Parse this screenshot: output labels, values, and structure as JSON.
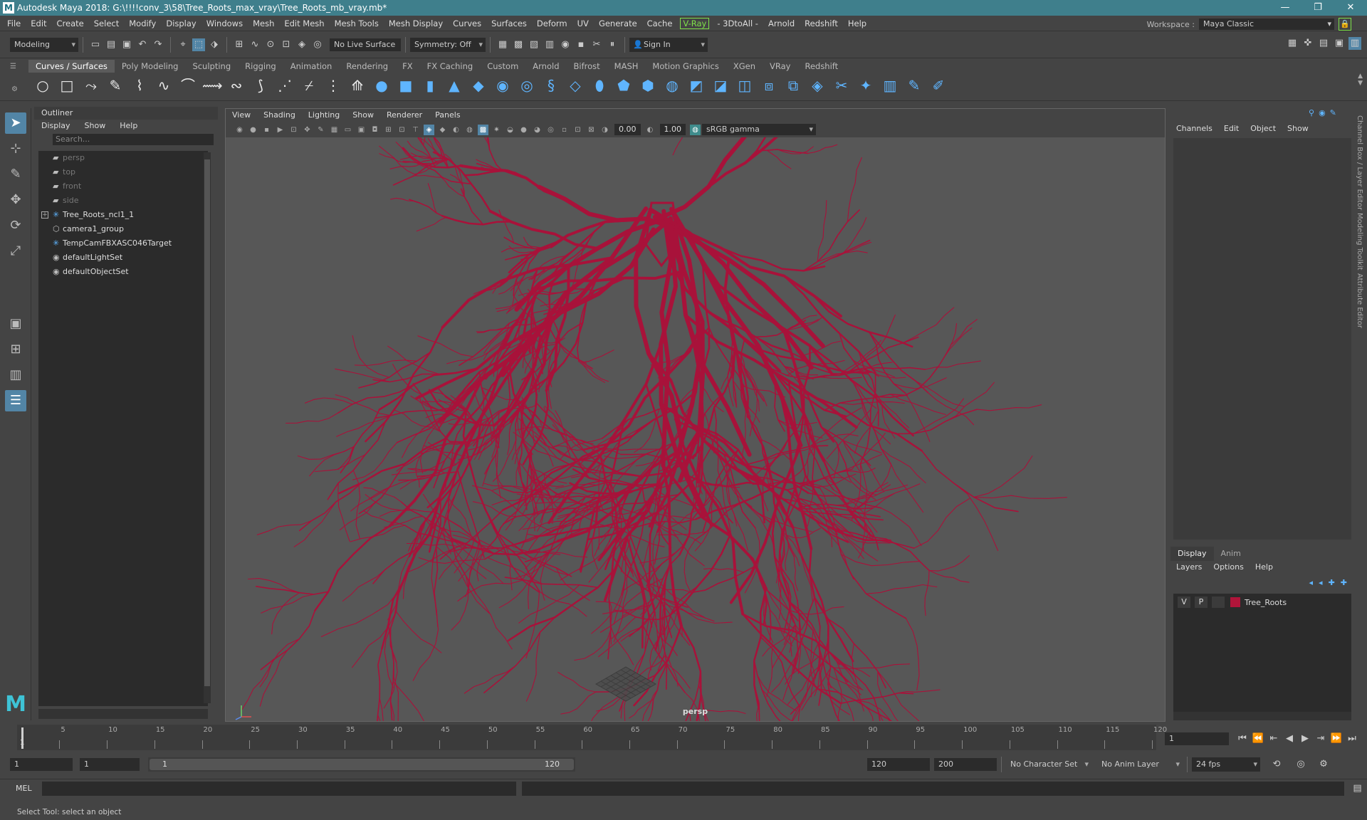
{
  "window": {
    "title": "Autodesk Maya 2018: G:\\!!!!conv_3\\58\\Tree_Roots_max_vray\\Tree_Roots_mb_vray.mb*",
    "logo": "M",
    "minimize": "—",
    "maximize": "❐",
    "close": "✕"
  },
  "menu": {
    "items": [
      "File",
      "Edit",
      "Create",
      "Select",
      "Modify",
      "Display",
      "Windows",
      "Mesh",
      "Edit Mesh",
      "Mesh Tools",
      "Mesh Display",
      "Curves",
      "Surfaces",
      "Deform",
      "UV",
      "Generate",
      "Cache"
    ],
    "vray": "V-Ray",
    "items2": [
      "- 3DtoAll -",
      "Arnold",
      "Redshift",
      "Help"
    ],
    "workspace_label": "Workspace :",
    "workspace_value": "Maya Classic"
  },
  "statusline": {
    "mode": "Modeling",
    "live_surface": "No Live Surface",
    "symmetry": "Symmetry: Off",
    "sign_in": "Sign In"
  },
  "shelf": {
    "tabs": [
      "Curves / Surfaces",
      "Poly Modeling",
      "Sculpting",
      "Rigging",
      "Animation",
      "Rendering",
      "FX",
      "FX Caching",
      "Custom",
      "Arnold",
      "Bifrost",
      "MASH",
      "Motion Graphics",
      "XGen",
      "VRay",
      "Redshift"
    ],
    "active_tab": "Curves / Surfaces"
  },
  "outliner": {
    "title": "Outliner",
    "menu": [
      "Display",
      "Show",
      "Help"
    ],
    "search_placeholder": "Search...",
    "items": [
      {
        "label": "persp",
        "icon": "camera-icon",
        "dim": true
      },
      {
        "label": "top",
        "icon": "camera-icon",
        "dim": true
      },
      {
        "label": "front",
        "icon": "camera-icon",
        "dim": true
      },
      {
        "label": "side",
        "icon": "camera-icon",
        "dim": true
      },
      {
        "label": "Tree_Roots_ncl1_1",
        "icon": "transform-icon",
        "dim": false,
        "expandable": true
      },
      {
        "label": "camera1_group",
        "icon": "group-icon",
        "dim": false
      },
      {
        "label": "TempCamFBXASC046Target",
        "icon": "transform-icon",
        "dim": false
      },
      {
        "label": "defaultLightSet",
        "icon": "set-icon",
        "dim": false
      },
      {
        "label": "defaultObjectSet",
        "icon": "set-icon",
        "dim": false
      }
    ]
  },
  "viewport": {
    "menu": [
      "View",
      "Shading",
      "Lighting",
      "Show",
      "Renderer",
      "Panels"
    ],
    "exposure": "0.00",
    "gamma": "1.00",
    "color_space": "sRGB gamma",
    "camera": "persp",
    "mesh_color": "#a8123a"
  },
  "channelbox": {
    "menu": [
      "Channels",
      "Edit",
      "Object",
      "Show"
    ],
    "side_tabs": [
      "Channel Box / Layer Editor",
      "Modeling Toolkit",
      "Attribute Editor"
    ]
  },
  "layers": {
    "tabs": [
      "Display",
      "Anim"
    ],
    "active_tab": "Display",
    "menu": [
      "Layers",
      "Options",
      "Help"
    ],
    "rows": [
      {
        "v": "V",
        "p": "P",
        "name": "Tree_Roots",
        "color": "#b0153a"
      }
    ]
  },
  "timeline": {
    "ticks": [
      "5",
      "10",
      "15",
      "20",
      "25",
      "30",
      "35",
      "40",
      "45",
      "50",
      "55",
      "60",
      "65",
      "70",
      "75",
      "80",
      "85",
      "90",
      "95",
      "100",
      "105",
      "110",
      "115",
      "120"
    ],
    "current_frame": "1",
    "first_tick": "1"
  },
  "range": {
    "start": "1",
    "playback_start": "1",
    "slider_start": "1",
    "slider_end": "120",
    "playback_end": "120",
    "end": "200",
    "character_set": "No Character Set",
    "anim_layer": "No Anim Layer",
    "fps": "24 fps"
  },
  "cmdline": {
    "lang": "MEL"
  },
  "helpline": {
    "text": "Select Tool: select an object"
  }
}
